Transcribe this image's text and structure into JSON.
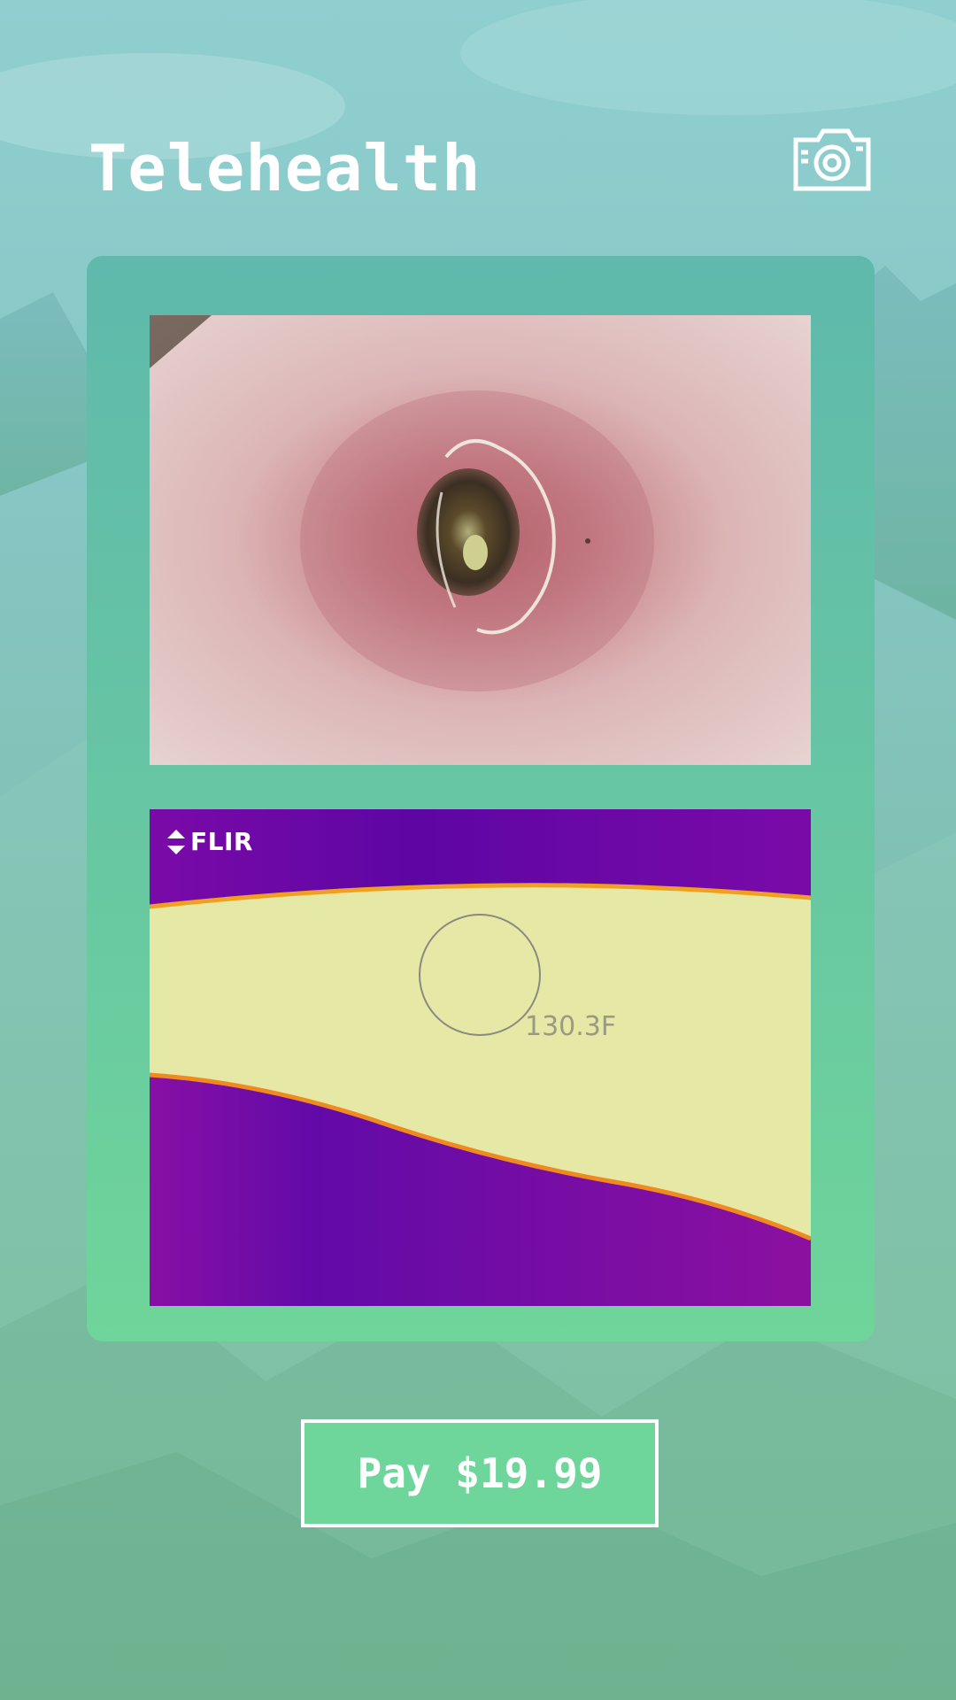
{
  "header": {
    "title": "Telehealth",
    "camera_icon": "camera-icon"
  },
  "card": {
    "photo": {
      "kind": "wound-photo"
    },
    "thermal": {
      "brand": "FLIR",
      "temperature": "130.3F"
    }
  },
  "action": {
    "pay_label": "Pay $19.99"
  },
  "colors": {
    "accent": "#6ed59b",
    "card_top": "#5fb9ac",
    "thermal_hot": "#e6e8a6",
    "thermal_cold": "#7a0aa8"
  }
}
